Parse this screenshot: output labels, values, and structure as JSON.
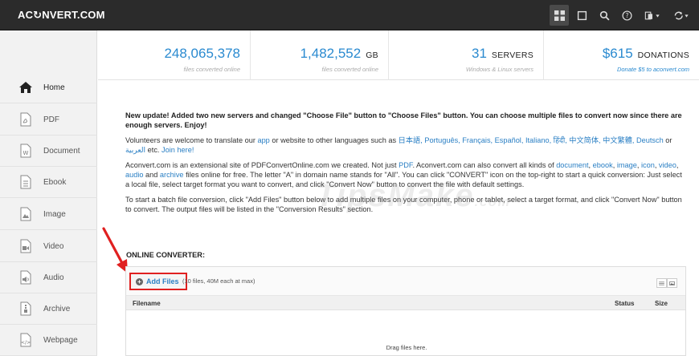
{
  "header": {
    "logo": "AC↻NVERT.COM",
    "icons": [
      "grid-icon",
      "window-icon",
      "search-icon",
      "help-icon",
      "language-icon",
      "convert-refresh-icon"
    ]
  },
  "sidebar": {
    "items": [
      {
        "label": "Home",
        "icon": "home-icon"
      },
      {
        "label": "PDF",
        "icon": "pdf-file-icon"
      },
      {
        "label": "Document",
        "icon": "word-document-icon"
      },
      {
        "label": "Ebook",
        "icon": "ebook-icon"
      },
      {
        "label": "Image",
        "icon": "image-file-icon"
      },
      {
        "label": "Video",
        "icon": "video-file-icon"
      },
      {
        "label": "Audio",
        "icon": "audio-file-icon"
      },
      {
        "label": "Archive",
        "icon": "archive-file-icon"
      },
      {
        "label": "Webpage",
        "icon": "webpage-file-icon"
      }
    ]
  },
  "stats": [
    {
      "number": "248,065,378",
      "unit": "",
      "sub": "files converted online"
    },
    {
      "number": "1,482,552",
      "unit": "GB",
      "sub": "files converted online"
    },
    {
      "number": "31",
      "unit": "SERVERS",
      "sub": "Windows & Linux servers"
    },
    {
      "number": "$615",
      "unit": "DONATIONS",
      "sub": "Donate $5 to aconvert.com"
    }
  ],
  "content": {
    "lead": "New update! Added two new servers and changed \"Choose File\" button to \"Choose Files\" button. You can choose multiple files to convert now since there are enough servers. Enjoy!",
    "p2_a": "Volunteers are welcome to translate our ",
    "p2_app": "app",
    "p2_b": " or website to other languages such as ",
    "p2_langs": "日本語, Português, Français, Español, Italiano, हिंदी, 中文简体, 中文繁體, Deutsch",
    "p2_c": " or ",
    "p2_arabic": "العربية",
    "p2_d": " etc. ",
    "p2_join": "Join here!",
    "p3_a": "Aconvert.com is an extensional site of PDFConvertOnline.com we created. Not just ",
    "p3_pdf": "PDF",
    "p3_b": ". Aconvert.com can also convert all kinds of ",
    "p3_doc": "document",
    "p3_c": ", ",
    "p3_ebook": "ebook",
    "p3_d": ", ",
    "p3_image": "image",
    "p3_e": ", ",
    "p3_icon": "icon",
    "p3_f": ", ",
    "p3_video": "video",
    "p3_g": ", ",
    "p3_audio": "audio",
    "p3_h": " and ",
    "p3_archive": "archive",
    "p3_i": " files online for free. The letter \"A\" in domain name stands for \"All\". You can click \"CONVERT\" icon on the top-right to start a quick conversion: Just select a local file, select target format you want to convert, and click \"Convert Now\" button to convert the file with default settings.",
    "p4": "To start a batch file conversion, click \"Add Files\" button below to add multiple files on your computer, phone or tablet, select a target format, and click \"Convert Now\" button to convert. The output files will be listed in the \"Conversion Results\" section."
  },
  "watermark": {
    "main": "TipsMake",
    "suffix": ".com"
  },
  "converter": {
    "title": "ONLINE CONVERTER:",
    "add_files": "Add Files",
    "limit": "(10 files, 40M each at max)",
    "columns": {
      "filename": "Filename",
      "status": "Status",
      "size": "Size"
    },
    "drop_text": "Drag files here."
  }
}
